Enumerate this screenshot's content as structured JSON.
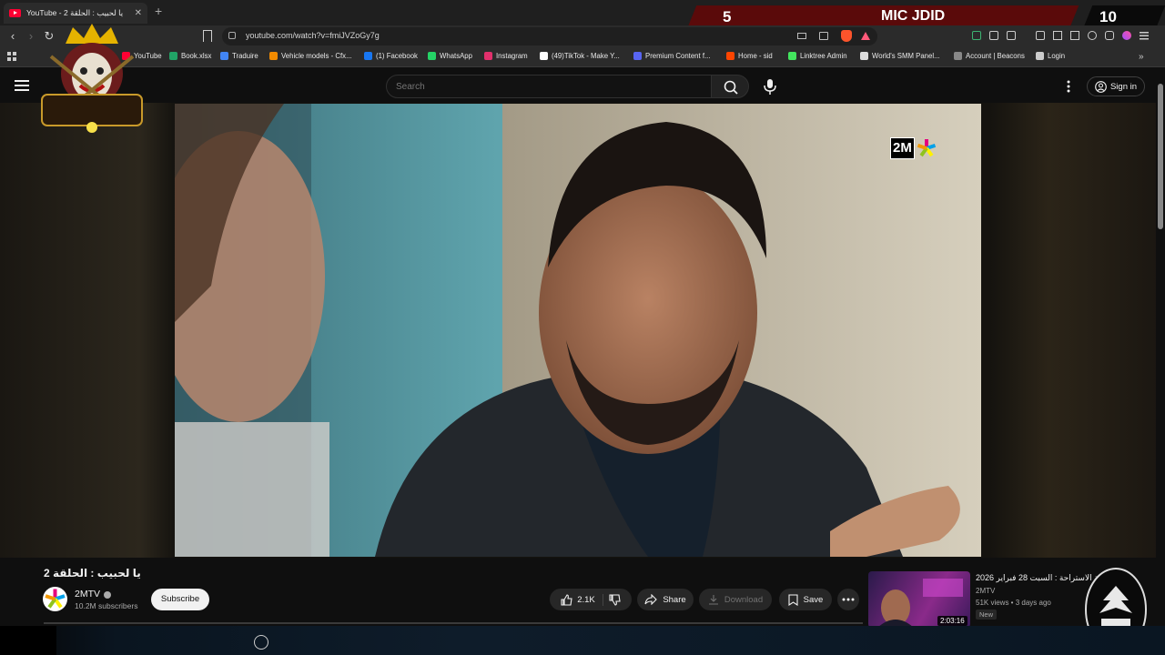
{
  "browser": {
    "tab_title": "YouTube - یا لحبیب : الحلقة 2",
    "new_tab": "+",
    "url": "youtube.com/watch?v=fmiJVZoGy7g",
    "bookmarks": [
      {
        "label": "YouTube",
        "color": "#ff0033"
      },
      {
        "label": "Book.xlsx",
        "color": "#21a366"
      },
      {
        "label": "Traduire",
        "color": "#4285f4"
      },
      {
        "label": "Vehicle models - Cfx...",
        "color": "#f28b00"
      },
      {
        "label": "(1) Facebook",
        "color": "#1877f2"
      },
      {
        "label": "WhatsApp",
        "color": "#25d366"
      },
      {
        "label": "Instagram",
        "color": "#e1306c"
      },
      {
        "label": "(49)TikTok - Make Y...",
        "color": "#ffffff"
      },
      {
        "label": "Premium Content f...",
        "color": "#5865f2"
      },
      {
        "label": "Home - sid",
        "color": "#ff4500"
      },
      {
        "label": "Linktree Admin",
        "color": "#43e55e"
      },
      {
        "label": "World's SMM Panel...",
        "color": "#dddddd"
      },
      {
        "label": "Account | Beacons",
        "color": "#888888"
      },
      {
        "label": "Login",
        "color": "#cccccc"
      }
    ]
  },
  "overlay": {
    "score": "5",
    "title": "MIC JDID",
    "timer": "10"
  },
  "header": {
    "search_placeholder": "Search",
    "sign_in": "Sign in"
  },
  "video": {
    "watermark": "2M",
    "title": "یا لحبیب : الحلقة 2",
    "channel": "2MTV",
    "subscribers": "10.2M subscribers",
    "subscribe": "Subscribe",
    "likes": "2.1K",
    "share": "Share",
    "download": "Download",
    "save": "Save"
  },
  "recommendation": {
    "title": "شلة الاستراحة : السبت 28 فبراير 2026",
    "channel": "2MTV",
    "meta": "51K views • 3 days ago",
    "badge": "New",
    "duration": "2:03:16"
  },
  "colors": {
    "accent_red": "#ff0033",
    "background": "#0f0f0f"
  }
}
